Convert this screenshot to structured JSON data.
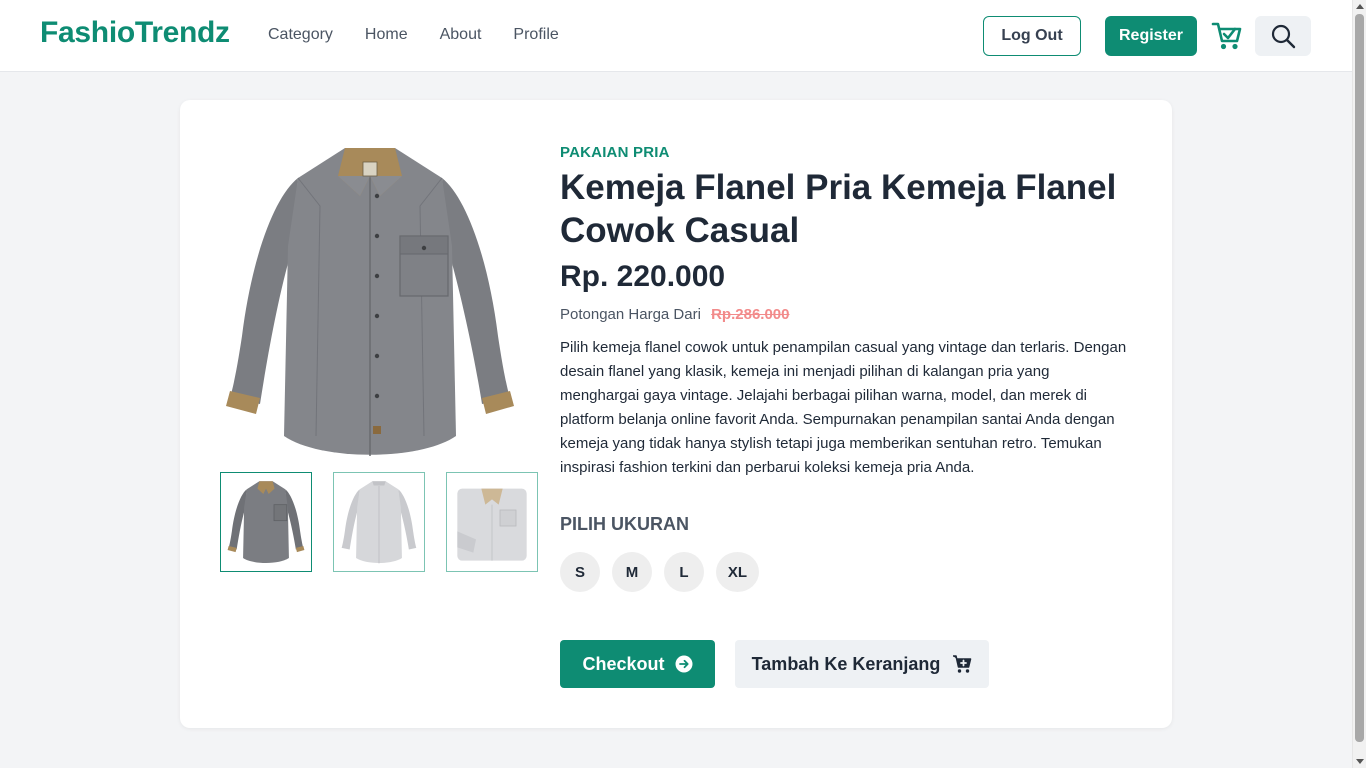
{
  "header": {
    "logo": "FashioTrendz",
    "nav": [
      "Category",
      "Home",
      "About",
      "Profile"
    ],
    "logout_label": "Log Out",
    "register_label": "Register"
  },
  "product": {
    "category": "PAKAIAN PRIA",
    "title": "Kemeja Flanel Pria Kemeja Flanel Cowok Casual",
    "price": "Rp. 220.000",
    "discount_label": "Potongan Harga Dari",
    "old_price": "Rp.286.000",
    "description": "Pilih kemeja flanel cowok untuk penampilan casual yang vintage dan terlaris. Dengan desain flanel yang klasik, kemeja ini menjadi pilihan di kalangan pria yang menghargai gaya vintage. Jelajahi berbagai pilihan warna, model, dan merek di platform belanja online favorit Anda. Sempurnakan penampilan santai Anda dengan kemeja yang tidak hanya stylish tetapi juga memberikan sentuhan retro. Temukan inspirasi fashion terkini dan perbarui koleksi kemeja pria Anda.",
    "size_label": "PILIH UKURAN",
    "sizes": [
      "S",
      "M",
      "L",
      "XL"
    ],
    "checkout_label": "Checkout",
    "add_to_cart_label": "Tambah Ke Keranjang"
  },
  "colors": {
    "brand": "#0e8c73",
    "old_price": "#f28b8b",
    "shirt_gray": "#7b7d82",
    "collar_tan": "#a88a5a",
    "shirt_light": "#d6d7da"
  },
  "icons": {
    "cart": "cart-check-icon",
    "search": "search-icon",
    "checkout": "arrow-right-circle-icon",
    "add_to_cart": "cart-plus-icon"
  }
}
